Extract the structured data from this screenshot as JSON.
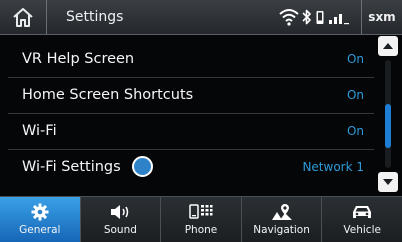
{
  "header": {
    "title": "Settings",
    "home_icon": "home-icon",
    "status_icons": [
      "wifi-icon",
      "bluetooth-icon",
      "phone-icon",
      "signal-icon"
    ],
    "sxm_label": "sxm"
  },
  "settings": {
    "rows": [
      {
        "label": "VR Help Screen",
        "value": "On"
      },
      {
        "label": "Home Screen Shortcuts",
        "value": "On"
      },
      {
        "label": "Wi-Fi",
        "value": "On"
      },
      {
        "label": "Wi-Fi Settings",
        "value": "Network 1"
      }
    ]
  },
  "scrollbar": {
    "up_icon": "triangle-up-icon",
    "down_icon": "triangle-down-icon"
  },
  "tabs": [
    {
      "label": "General",
      "icon": "gear-icon",
      "active": true
    },
    {
      "label": "Sound",
      "icon": "speaker-icon",
      "active": false
    },
    {
      "label": "Phone",
      "icon": "phone-keypad-icon",
      "active": false
    },
    {
      "label": "Navigation",
      "icon": "map-pin-icon",
      "active": false
    },
    {
      "label": "Vehicle",
      "icon": "car-icon",
      "active": false
    }
  ],
  "colors": {
    "accent": "#2f9ad8",
    "active_tab": "#1f7fd6",
    "background": "#050607"
  }
}
